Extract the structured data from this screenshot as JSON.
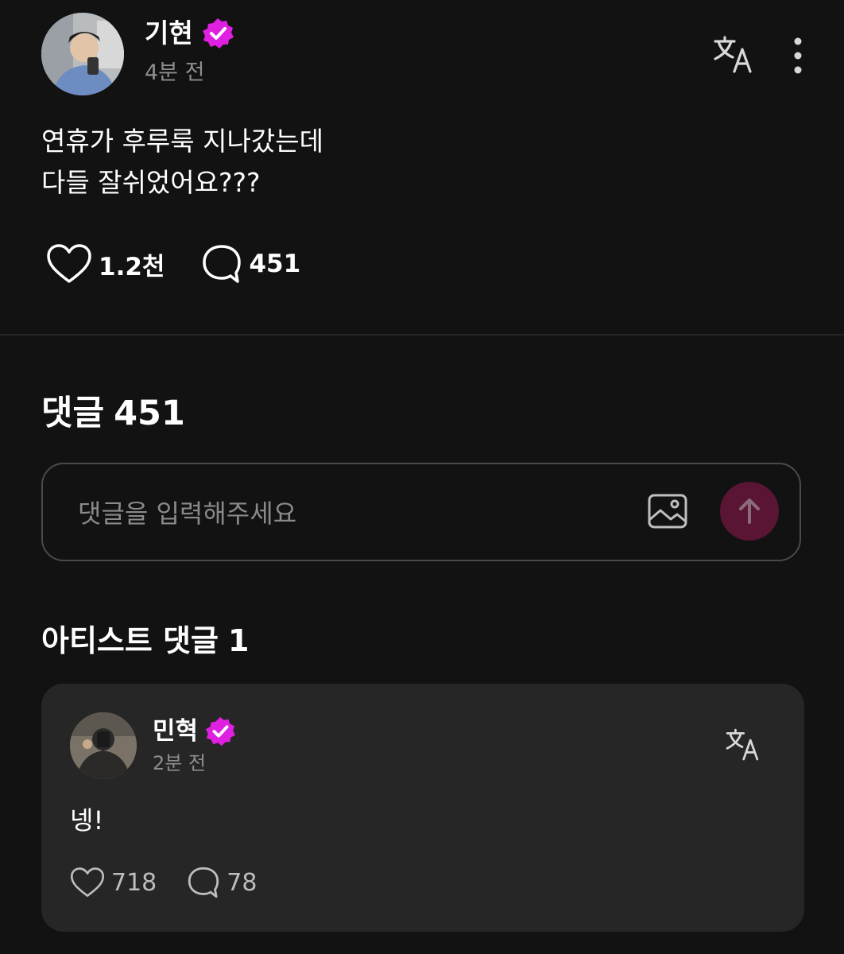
{
  "post": {
    "author": "기현",
    "time": "4분 전",
    "body_lines": [
      "연휴가 후루룩 지나갔는데",
      "다들 잘쉬었어요???"
    ],
    "likes": "1.2천",
    "comments": "451"
  },
  "comments_section": {
    "label": "댓글",
    "count": "451",
    "input_placeholder": "댓글을 입력해주세요"
  },
  "artist_section": {
    "label": "아티스트 댓글",
    "count": "1"
  },
  "artist_comment": {
    "author": "민혁",
    "time": "2분 전",
    "body": "넹!",
    "likes": "718",
    "replies": "78"
  },
  "icons": {
    "verified_badge": "verified-badge-icon",
    "translate": "translate-icon",
    "more": "more-vertical-icon",
    "like": "heart-icon",
    "comment": "comment-bubble-icon",
    "image": "image-icon",
    "send": "arrow-up-icon"
  },
  "colors": {
    "background": "#121212",
    "verified": "#e020e0",
    "send_button": "#5a1535",
    "card": "#262626",
    "muted_text": "#8e8e8e"
  }
}
